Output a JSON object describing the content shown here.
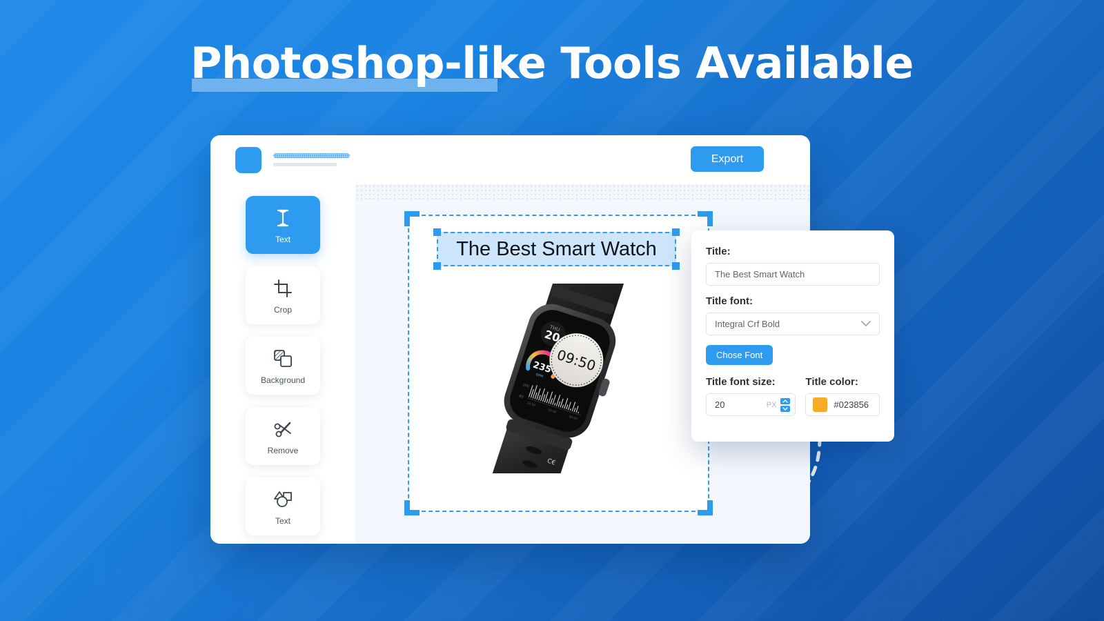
{
  "page": {
    "headline": "Photoshop-like Tools Available",
    "headline_underline_color": "#6eb3f0",
    "background_color_start": "#1e8ae8",
    "background_color_end": "#0f4e9e",
    "accent_color": "#2d9cf0"
  },
  "app": {
    "header": {
      "logo_icon": "app-logo-square",
      "export_label": "Export"
    },
    "sidebar": {
      "tools": [
        {
          "label": "Text",
          "icon": "text-cursor-icon",
          "active": true
        },
        {
          "label": "Crop",
          "icon": "crop-icon",
          "active": false
        },
        {
          "label": "Background",
          "icon": "layers-icon",
          "active": false
        },
        {
          "label": "Remove",
          "icon": "scissors-icon",
          "active": false
        },
        {
          "label": "Text",
          "icon": "shapes-icon",
          "active": false
        }
      ]
    },
    "canvas": {
      "text_object": "The Best Smart Watch",
      "selection_color": "#2d9cf0",
      "text_highlight_color": "#cde6fb",
      "product": {
        "name": "smart-watch",
        "watch_face": {
          "weekday": "THU",
          "day": "20",
          "time": "09:50",
          "bpm_value": "235",
          "bpm_unit": "BPM",
          "chart_axis_high": "200",
          "chart_axis_low": "80",
          "chart_ticks": [
            "24:00",
            "02:00",
            "00:00"
          ]
        }
      }
    },
    "properties": {
      "title_label": "Title:",
      "title_value": "The Best Smart Watch",
      "title_font_label": "Title font:",
      "title_font_value": "Integral Crf Bold",
      "chose_font_label": "Chose Font",
      "font_size_label": "Title font size:",
      "font_size_value": "20",
      "font_size_unit": "PX",
      "color_label": "Title color:",
      "color_hex": "#023856",
      "color_swatch": "#f7ab29",
      "dropdown_icon": "chevron-down-icon",
      "stepper_up_icon": "caret-up-icon",
      "stepper_down_icon": "caret-down-icon"
    }
  }
}
